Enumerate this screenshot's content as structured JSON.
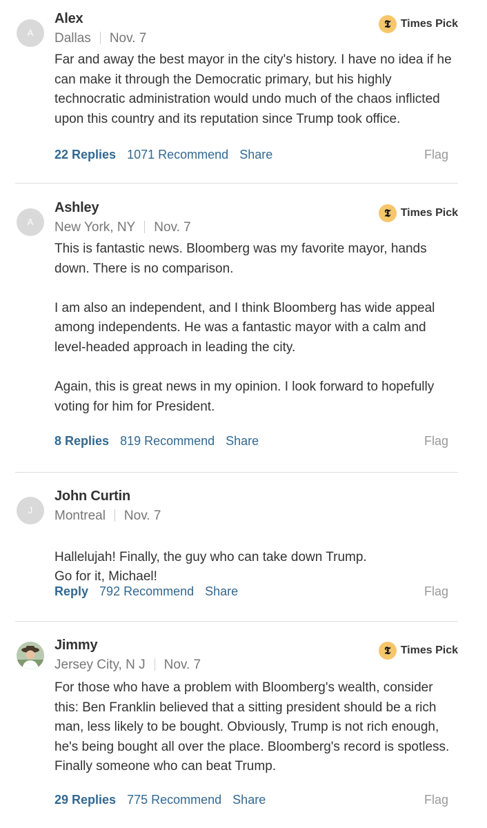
{
  "badge_label": "Times Pick",
  "comments": [
    {
      "avatar_letter": "A",
      "name": "Alex",
      "location": "Dallas",
      "date": "Nov. 7",
      "times_pick": true,
      "paragraphs": [
        "Far and away the best mayor in the city's history. I have no idea if he can make it through the Democratic primary, but his highly technocratic administration would undo much of the chaos inflicted upon this country and its reputation since Trump took office."
      ],
      "replies": "22 Replies",
      "recommend": "1071 Recommend",
      "share": "Share",
      "flag": "Flag"
    },
    {
      "avatar_letter": "A",
      "name": "Ashley",
      "location": "New York, NY",
      "date": "Nov. 7",
      "times_pick": true,
      "paragraphs": [
        "This is fantastic news. Bloomberg was my favorite mayor, hands down. There is no comparison.",
        "I am also an independent, and I think Bloomberg has wide appeal among independents. He was a fantastic mayor with a calm and level-headed approach in leading the city.",
        "Again, this is great news in my opinion. I look forward to hopefully voting for him for President."
      ],
      "replies": "8 Replies",
      "recommend": "819 Recommend",
      "share": "Share",
      "flag": "Flag"
    },
    {
      "avatar_letter": "J",
      "name": "John Curtin",
      "location": "Montreal",
      "date": "Nov. 7",
      "times_pick": false,
      "paragraphs": [
        "Hallelujah! Finally, the guy who can take down Trump.\nGo for it, Michael!"
      ],
      "replies": "Reply",
      "recommend": "792 Recommend",
      "share": "Share",
      "flag": "Flag"
    },
    {
      "avatar_letter": "",
      "name": "Jimmy",
      "location": "Jersey City, N J",
      "date": "Nov. 7",
      "times_pick": true,
      "paragraphs": [
        "For those who have a problem with Bloomberg's wealth, consider this: Ben Franklin believed that a sitting president should be a rich man, less likely to be bought. Obviously, Trump is not rich enough, he's being bought all over the place. Bloomberg's record is spotless. Finally someone who can beat Trump."
      ],
      "replies": "29 Replies",
      "recommend": "775 Recommend",
      "share": "Share",
      "flag": "Flag"
    }
  ],
  "colors": {
    "link": "#326891",
    "badge": "#f6c66a",
    "muted": "#777777",
    "flag": "#999999"
  },
  "icons": {
    "times_pick": "nyt-t-logo-icon",
    "avatar_placeholder": "initial-avatar",
    "avatar_photo": "user-photo-avatar"
  }
}
